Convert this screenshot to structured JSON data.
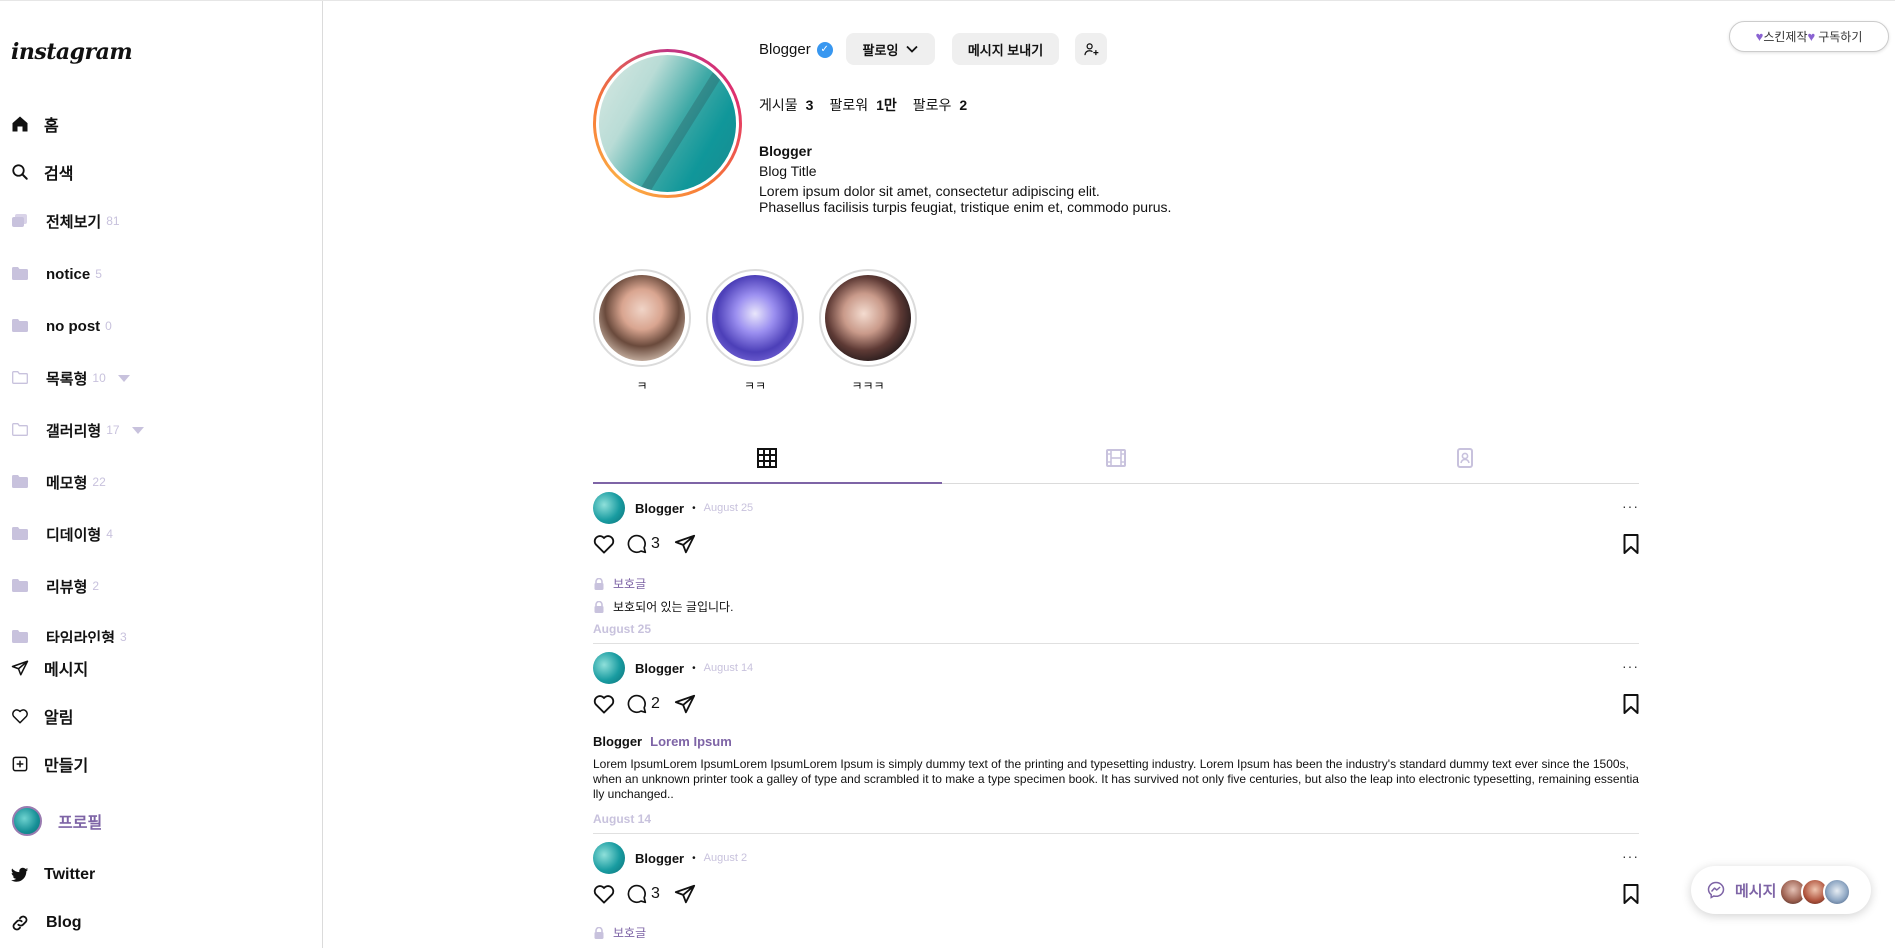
{
  "brand": {
    "logo": "instagram"
  },
  "nav": {
    "home": "홈",
    "search": "검색",
    "messages": "메시지",
    "notifications": "알림",
    "create": "만들기",
    "profile": "프로필",
    "twitter": "Twitter",
    "blog": "Blog"
  },
  "categories": [
    {
      "label": "전체보기",
      "count": "81"
    },
    {
      "label": "notice",
      "count": "5"
    },
    {
      "label": "no post",
      "count": "0"
    },
    {
      "label": "목록형",
      "count": "10"
    },
    {
      "label": "갤러리형",
      "count": "17"
    },
    {
      "label": "메모형",
      "count": "22"
    },
    {
      "label": "디데이형",
      "count": "4"
    },
    {
      "label": "리뷰형",
      "count": "2"
    },
    {
      "label": "타임라인형",
      "count": "3"
    }
  ],
  "profile": {
    "username": "Blogger",
    "follow_label": "팔로잉",
    "message_label": "메시지 보내기",
    "stats": {
      "posts_label": "게시물",
      "posts": "3",
      "followers_label": "팔로워",
      "followers": "1만",
      "following_label": "팔로우",
      "following": "2"
    },
    "bio_name": "Blogger",
    "bio_title": "Blog Title",
    "bio_line1": "Lorem ipsum dolor sit amet, consectetur adipiscing elit.",
    "bio_line2": "Phasellus facilisis turpis feugiat, tristique enim et, commodo purus."
  },
  "highlights": [
    {
      "caption": "ㅋ"
    },
    {
      "caption": "ㅋㅋ"
    },
    {
      "caption": "ㅋㅋㅋ"
    }
  ],
  "posts": [
    {
      "author": "Blogger",
      "date": "August 25",
      "comments": "3",
      "category": "보호글",
      "text": "보호되어 있는 글입니다.",
      "footer_date": "August 25"
    },
    {
      "author": "Blogger",
      "date": "August 14",
      "comments": "2",
      "title_author": "Blogger",
      "title": "Lorem Ipsum",
      "text": "Lorem IpsumLorem IpsumLorem IpsumLorem Ipsum is simply dummy text of the printing and typesetting industry. Lorem Ipsum has been the industry's standard dummy text ever since the 1500s, when an unknown printer took a galley of type and scrambled it to make a type specimen book. It has survived not only five centuries, but also the leap into electronic typesetting, remaining essentially unchanged..",
      "footer_date": "August 14"
    },
    {
      "author": "Blogger",
      "date": "August 2",
      "comments": "3",
      "category": "보호글"
    }
  ],
  "floating": {
    "skin_label": "스킨제작",
    "subscribe_label": "구독하기",
    "messages_label": "메시지"
  },
  "colors": {
    "accent": "#7e64a6",
    "muted": "#c8c2dd",
    "verified": "#3897f0"
  }
}
